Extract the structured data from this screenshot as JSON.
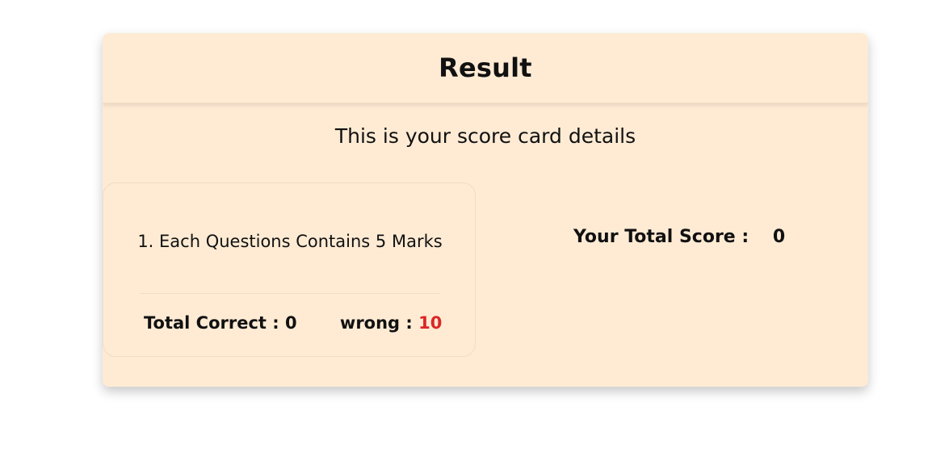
{
  "result_card": {
    "title": "Result",
    "subtitle": "This is your score card details",
    "rule": "1. Each Questions Contains 5 Marks",
    "correct_label": "Total Correct :",
    "correct_value": "0",
    "wrong_label": "wrong :",
    "wrong_value": "10",
    "total_score_label": "Your Total Score :",
    "total_score_value": "0"
  },
  "colors": {
    "card_background": "#ffebd4",
    "wrong_value": "#dc2626"
  }
}
